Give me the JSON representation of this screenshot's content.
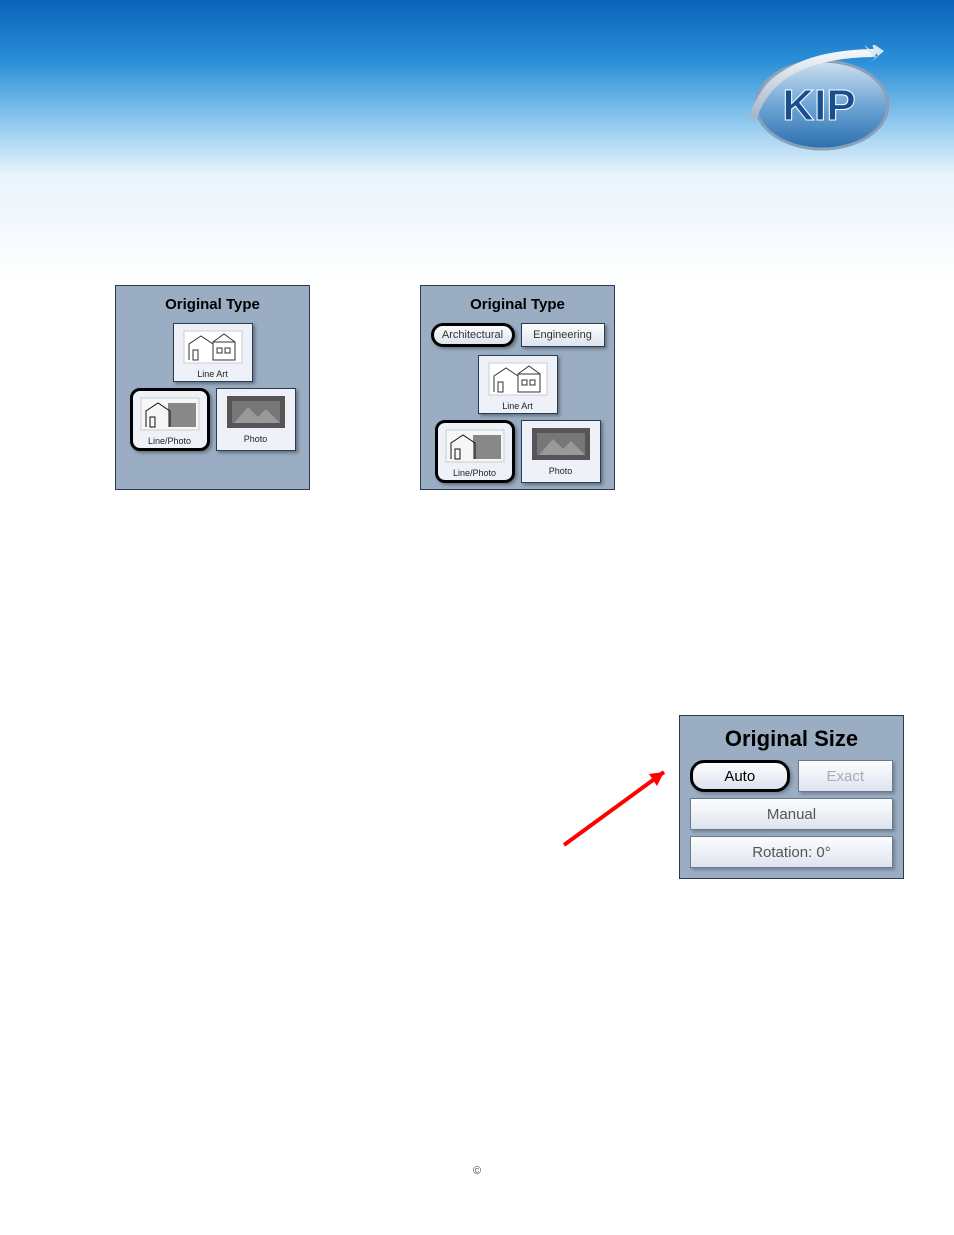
{
  "logo": {
    "text": "KIP"
  },
  "panels": {
    "left": {
      "title": "Original Type",
      "options": {
        "lineart": {
          "label": "Line Art",
          "selected": false
        },
        "linephoto": {
          "label": "Line/Photo",
          "selected": true
        },
        "photo": {
          "label": "Photo",
          "selected": false
        }
      }
    },
    "right": {
      "title": "Original Type",
      "category": {
        "architectural": {
          "label": "Architectural",
          "selected": true
        },
        "engineering": {
          "label": "Engineering",
          "selected": false
        }
      },
      "options": {
        "lineart": {
          "label": "Line Art",
          "selected": false
        },
        "linephoto": {
          "label": "Line/Photo",
          "selected": true
        },
        "photo": {
          "label": "Photo",
          "selected": false
        }
      }
    }
  },
  "size": {
    "title": "Original Size",
    "auto": {
      "label": "Auto",
      "selected": true
    },
    "exact": {
      "label": "Exact",
      "disabled": true
    },
    "manual": {
      "label": "Manual"
    },
    "rotation": {
      "label": "Rotation: 0°"
    }
  },
  "footer": {
    "copyright": "©"
  }
}
